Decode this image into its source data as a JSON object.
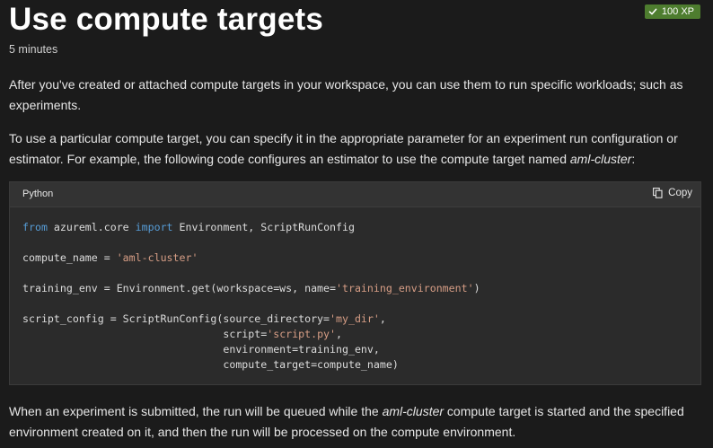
{
  "header": {
    "title": "Use compute targets",
    "duration": "5 minutes",
    "xp_badge": "100 XP"
  },
  "content": {
    "p1": "After you've created or attached compute targets in your workspace, you can use them to run specific workloads; such as experiments.",
    "p2_text": "To use a particular compute target, you can specify it in the appropriate parameter for an experiment run configuration or estimator. For example, the following code configures an estimator to use the compute target named ",
    "p2_em": "aml-cluster",
    "p2_end": ":",
    "p3_start": "When an experiment is submitted, the run will be queued while the ",
    "p3_em": "aml-cluster",
    "p3_end": " compute target is started and the specified environment created on it, and then the run will be processed on the compute environment."
  },
  "code": {
    "language": "Python",
    "copy_label": "Copy",
    "lines": [
      [
        {
          "t": "from",
          "c": "kw"
        },
        {
          "t": " azureml.core "
        },
        {
          "t": "import",
          "c": "kw"
        },
        {
          "t": " Environment, ScriptRunConfig"
        }
      ],
      [],
      [
        {
          "t": "compute_name = "
        },
        {
          "t": "'aml-cluster'",
          "c": "str"
        }
      ],
      [],
      [
        {
          "t": "training_env = Environment.get(workspace=ws, name="
        },
        {
          "t": "'training_environment'",
          "c": "str"
        },
        {
          "t": ")"
        }
      ],
      [],
      [
        {
          "t": "script_config = ScriptRunConfig(source_directory="
        },
        {
          "t": "'my_dir'",
          "c": "str"
        },
        {
          "t": ","
        }
      ],
      [
        {
          "t": "                                script="
        },
        {
          "t": "'script.py'",
          "c": "str"
        },
        {
          "t": ","
        }
      ],
      [
        {
          "t": "                                environment=training_env,"
        }
      ],
      [
        {
          "t": "                                compute_target=compute_name)"
        }
      ]
    ]
  },
  "colors": {
    "background": "#1b1b1b",
    "badge": "#4e7d2f",
    "keyword": "#569cd6",
    "string": "#d69d85"
  },
  "icons": {
    "badge_icon": "check-icon",
    "copy_icon": "copy-icon"
  }
}
